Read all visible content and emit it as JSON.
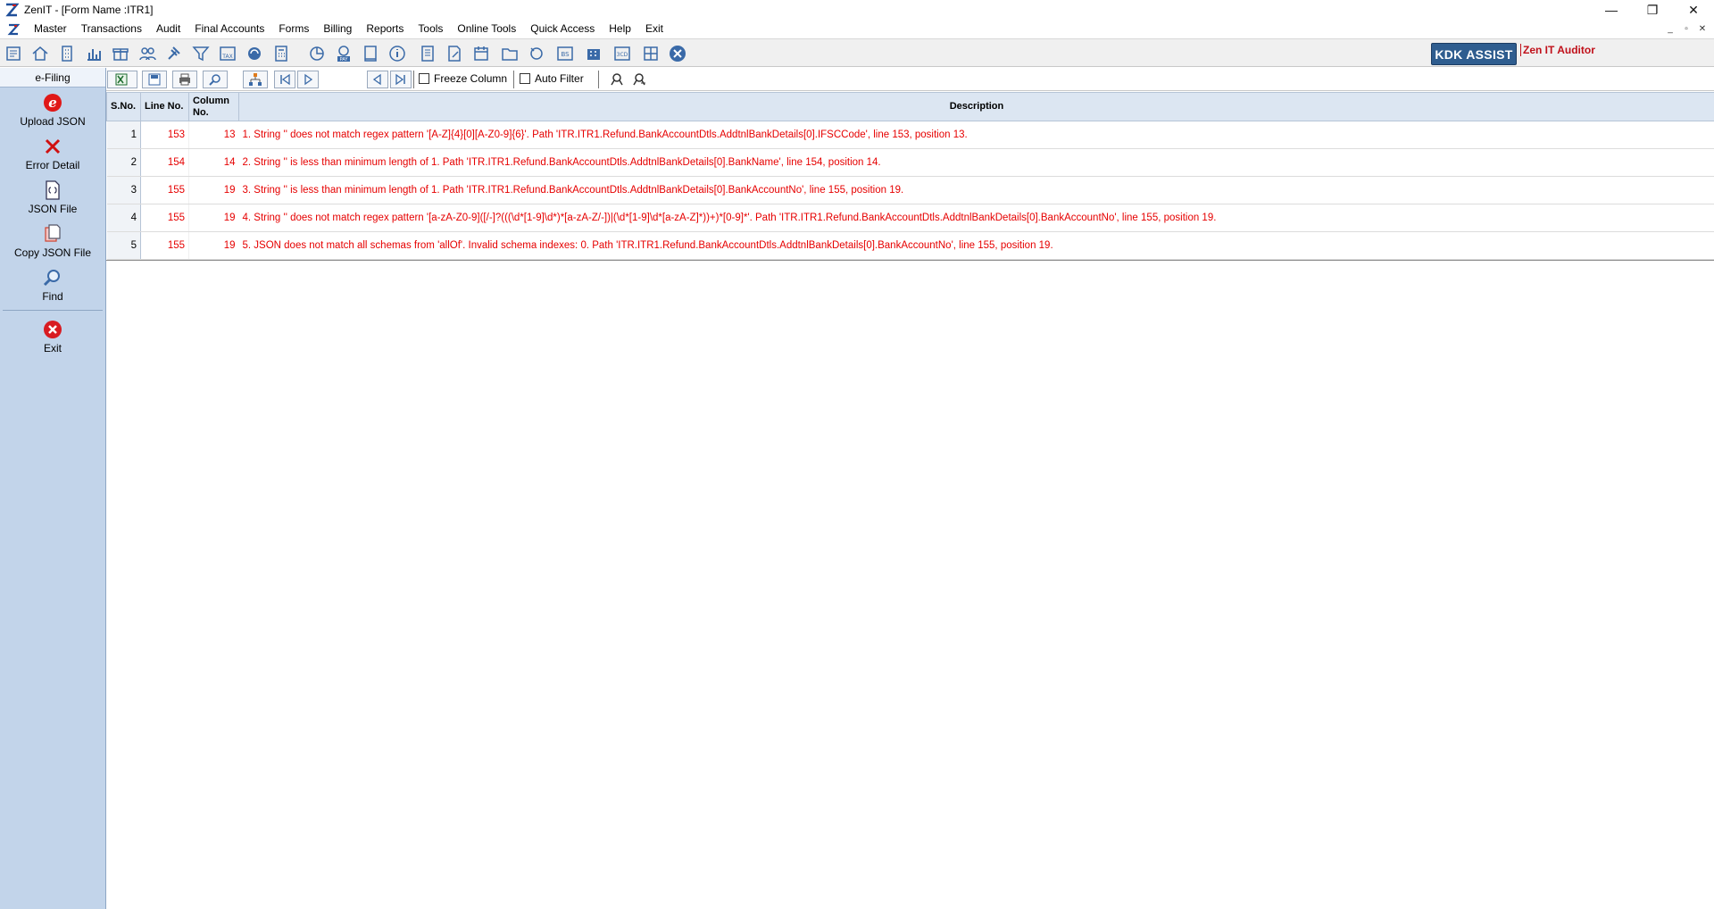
{
  "window": {
    "title": "ZenIT - [Form Name :ITR1]",
    "controls": [
      "—",
      "❐",
      "✕"
    ],
    "mdi_controls": [
      "_",
      "▫",
      "✕"
    ]
  },
  "menu": {
    "items": [
      "Master",
      "Transactions",
      "Audit",
      "Final Accounts",
      "Forms",
      "Billing",
      "Reports",
      "Tools",
      "Online Tools",
      "Quick Access",
      "Help",
      "Exit"
    ]
  },
  "toolbar": {
    "kdk_label": "KDK ASSIST",
    "auditor_label": "Zen IT Auditor"
  },
  "sidebar": {
    "header": "e-Filing",
    "items": [
      {
        "label": "Upload JSON",
        "icon": "efiling-e-icon"
      },
      {
        "label": "Error Detail",
        "icon": "error-x-icon"
      },
      {
        "label": "JSON File",
        "icon": "json-file-icon"
      },
      {
        "label": "Copy JSON File",
        "icon": "copy-file-icon"
      },
      {
        "label": "Find",
        "icon": "magnifier-icon"
      },
      {
        "label": "Exit",
        "icon": "exit-circle-icon"
      }
    ]
  },
  "gridbar": {
    "freeze_column": "Freeze Column",
    "auto_filter": "Auto Filter"
  },
  "table": {
    "headers": {
      "sno": "S.No.",
      "line": "Line No.",
      "column": "Column No.",
      "description": "Description"
    },
    "rows": [
      {
        "sno": "1",
        "line": "153",
        "col": "13",
        "desc": "1. String '' does not match regex pattern '[A-Z]{4}[0][A-Z0-9]{6}'. Path 'ITR.ITR1.Refund.BankAccountDtls.AddtnlBankDetails[0].IFSCCode', line 153, position 13."
      },
      {
        "sno": "2",
        "line": "154",
        "col": "14",
        "desc": "2. String '' is less than minimum length of 1. Path 'ITR.ITR1.Refund.BankAccountDtls.AddtnlBankDetails[0].BankName', line 154, position 14."
      },
      {
        "sno": "3",
        "line": "155",
        "col": "19",
        "desc": "3. String '' is less than minimum length of 1. Path 'ITR.ITR1.Refund.BankAccountDtls.AddtnlBankDetails[0].BankAccountNo', line 155, position 19."
      },
      {
        "sno": "4",
        "line": "155",
        "col": "19",
        "desc": "4. String '' does not match regex pattern '[a-zA-Z0-9]([/-]?(((\\d*[1-9]\\d*)*[a-zA-Z/-])|(\\d*[1-9]\\d*[a-zA-Z]*))+)*[0-9]*'. Path 'ITR.ITR1.Refund.BankAccountDtls.AddtnlBankDetails[0].BankAccountNo', line 155, position 19."
      },
      {
        "sno": "5",
        "line": "155",
        "col": "19",
        "desc": "5. JSON does not match all schemas from 'allOf'. Invalid schema indexes: 0. Path 'ITR.ITR1.Refund.BankAccountDtls.AddtnlBankDetails[0].BankAccountNo', line 155, position 19."
      }
    ]
  },
  "colors": {
    "sidebar_bg": "#c2d4ea",
    "error_text": "#e60000",
    "kdk_bg": "#2f5d8f",
    "auditor_text": "#c0101a"
  }
}
